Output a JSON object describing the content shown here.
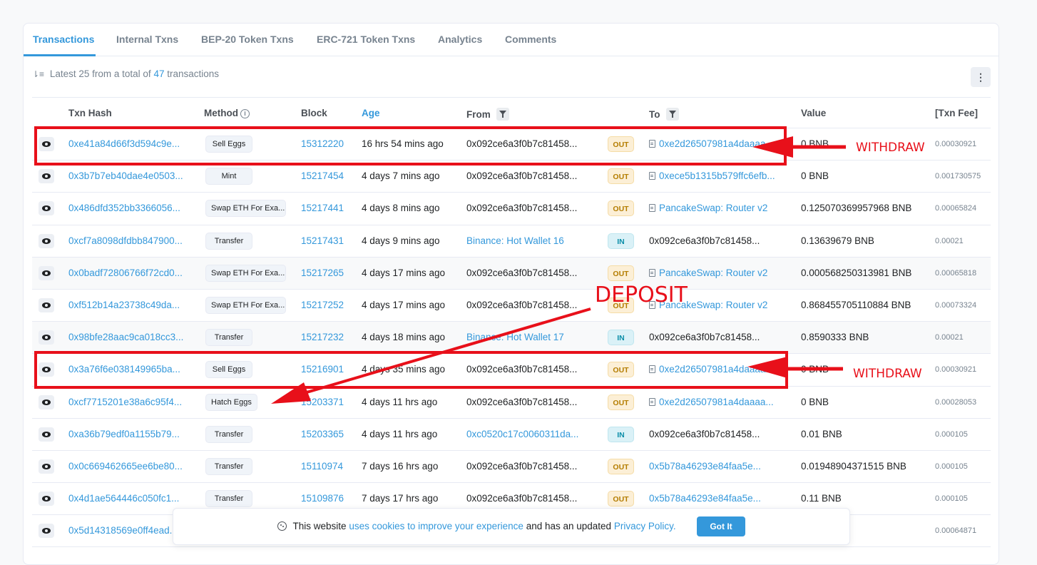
{
  "tabs": [
    "Transactions",
    "Internal Txns",
    "BEP-20 Token Txns",
    "ERC-721 Token Txns",
    "Analytics",
    "Comments"
  ],
  "summary": {
    "prefix": "Latest 25 from a total of",
    "count": "47",
    "suffix": "transactions"
  },
  "more_button_icon": "vertical-ellipsis-icon",
  "table": {
    "headers": {
      "hash": "Txn Hash",
      "method": "Method",
      "block": "Block",
      "age": "Age",
      "from": "From",
      "to": "To",
      "value": "Value",
      "fee": "[Txn Fee]"
    },
    "rows": [
      {
        "hash": "0xe41a84d66f3d594c9e...",
        "method": "Sell Eggs",
        "block": "15312220",
        "age": "16 hrs 54 mins ago",
        "from": "0x092ce6a3f0b7c81458...",
        "from_link": false,
        "dir": "OUT",
        "to": "0xe2d26507981a4daaaa...",
        "to_link": true,
        "to_contract": true,
        "value": "0 BNB",
        "fee": "0.00030921"
      },
      {
        "hash": "0x3b7b7eb40dae4e0503...",
        "method": "Mint",
        "block": "15217454",
        "age": "4 days 7 mins ago",
        "from": "0x092ce6a3f0b7c81458...",
        "from_link": false,
        "dir": "OUT",
        "to": "0xece5b1315b579ffc6efb...",
        "to_link": true,
        "to_contract": true,
        "value": "0 BNB",
        "fee": "0.001730575"
      },
      {
        "hash": "0x486dfd352bb3366056...",
        "method": "Swap ETH For Exa...",
        "block": "15217441",
        "age": "4 days 8 mins ago",
        "from": "0x092ce6a3f0b7c81458...",
        "from_link": false,
        "dir": "OUT",
        "to": "PancakeSwap: Router v2",
        "to_link": true,
        "to_contract": true,
        "value": "0.125070369957968 BNB",
        "fee": "0.00065824"
      },
      {
        "hash": "0xcf7a8098dfdbb847900...",
        "method": "Transfer",
        "block": "15217431",
        "age": "4 days 9 mins ago",
        "from": "Binance: Hot Wallet 16",
        "from_link": true,
        "dir": "IN",
        "to": "0x092ce6a3f0b7c81458...",
        "to_link": false,
        "to_contract": false,
        "value": "0.13639679 BNB",
        "fee": "0.00021"
      },
      {
        "hash": "0x0badf72806766f72cd0...",
        "method": "Swap ETH For Exa...",
        "block": "15217265",
        "age": "4 days 17 mins ago",
        "from": "0x092ce6a3f0b7c81458...",
        "from_link": false,
        "dir": "OUT",
        "to": "PancakeSwap: Router v2",
        "to_link": true,
        "to_contract": true,
        "value": "0.000568250313981 BNB",
        "fee": "0.00065818"
      },
      {
        "hash": "0xf512b14a23738c49da...",
        "method": "Swap ETH For Exa...",
        "block": "15217252",
        "age": "4 days 17 mins ago",
        "from": "0x092ce6a3f0b7c81458...",
        "from_link": false,
        "dir": "OUT",
        "to": "PancakeSwap: Router v2",
        "to_link": true,
        "to_contract": true,
        "value": "0.868455705110884 BNB",
        "fee": "0.00073324"
      },
      {
        "hash": "0x98bfe28aac9ca018cc3...",
        "method": "Transfer",
        "block": "15217232",
        "age": "4 days 18 mins ago",
        "from": "Binance: Hot Wallet 17",
        "from_link": true,
        "dir": "IN",
        "to": "0x092ce6a3f0b7c81458...",
        "to_link": false,
        "to_contract": false,
        "value": "0.8590333 BNB",
        "fee": "0.00021"
      },
      {
        "hash": "0x3a76f6e038149965ba...",
        "method": "Sell Eggs",
        "block": "15216901",
        "age": "4 days 35 mins ago",
        "from": "0x092ce6a3f0b7c81458...",
        "from_link": false,
        "dir": "OUT",
        "to": "0xe2d26507981a4daaaa...",
        "to_link": true,
        "to_contract": true,
        "value": "0 BNB",
        "fee": "0.00030921"
      },
      {
        "hash": "0xcf7715201e38a6c95f4...",
        "method": "Hatch Eggs",
        "block": "15203371",
        "age": "4 days 11 hrs ago",
        "from": "0x092ce6a3f0b7c81458...",
        "from_link": false,
        "dir": "OUT",
        "to": "0xe2d26507981a4daaaa...",
        "to_link": true,
        "to_contract": true,
        "value": "0 BNB",
        "fee": "0.00028053"
      },
      {
        "hash": "0xa36b79edf0a1155b79...",
        "method": "Transfer",
        "block": "15203365",
        "age": "4 days 11 hrs ago",
        "from": "0xc0520c17c0060311da...",
        "from_link": true,
        "dir": "IN",
        "to": "0x092ce6a3f0b7c81458...",
        "to_link": false,
        "to_contract": false,
        "value": "0.01 BNB",
        "fee": "0.000105"
      },
      {
        "hash": "0x0c669462665ee6be80...",
        "method": "Transfer",
        "block": "15110974",
        "age": "7 days 16 hrs ago",
        "from": "0x092ce6a3f0b7c81458...",
        "from_link": false,
        "dir": "OUT",
        "to": "0x5b78a46293e84faa5e...",
        "to_link": true,
        "to_contract": false,
        "value": "0.01948904371515 BNB",
        "fee": "0.000105"
      },
      {
        "hash": "0x4d1ae564446c050fc1...",
        "method": "Transfer",
        "block": "15109876",
        "age": "7 days 17 hrs ago",
        "from": "0x092ce6a3f0b7c81458...",
        "from_link": false,
        "dir": "OUT",
        "to": "0x5b78a46293e84faa5e...",
        "to_link": true,
        "to_contract": false,
        "value": "0.11 BNB",
        "fee": "0.000105"
      },
      {
        "hash": "0x5d14318569e0ff4ead...",
        "method": "",
        "block": "",
        "age": "",
        "from": "",
        "from_link": false,
        "dir": "",
        "to": "",
        "to_link": false,
        "to_contract": false,
        "value": "",
        "fee": "0.00064871"
      }
    ]
  },
  "annotations": {
    "withdraw_1": "WITHDRAW",
    "withdraw_2": "WITHDRAW",
    "deposit": "DEPOSIT",
    "color": "#e8101a"
  },
  "cookie_banner": {
    "text_1": "This website",
    "link_1": "uses cookies to improve your experience",
    "text_2": "and has an updated",
    "link_2": "Privacy Policy.",
    "button": "Got It"
  },
  "colors": {
    "link": "#3498db",
    "out_badge": "#fcefd6",
    "in_badge": "#daf1f7"
  }
}
